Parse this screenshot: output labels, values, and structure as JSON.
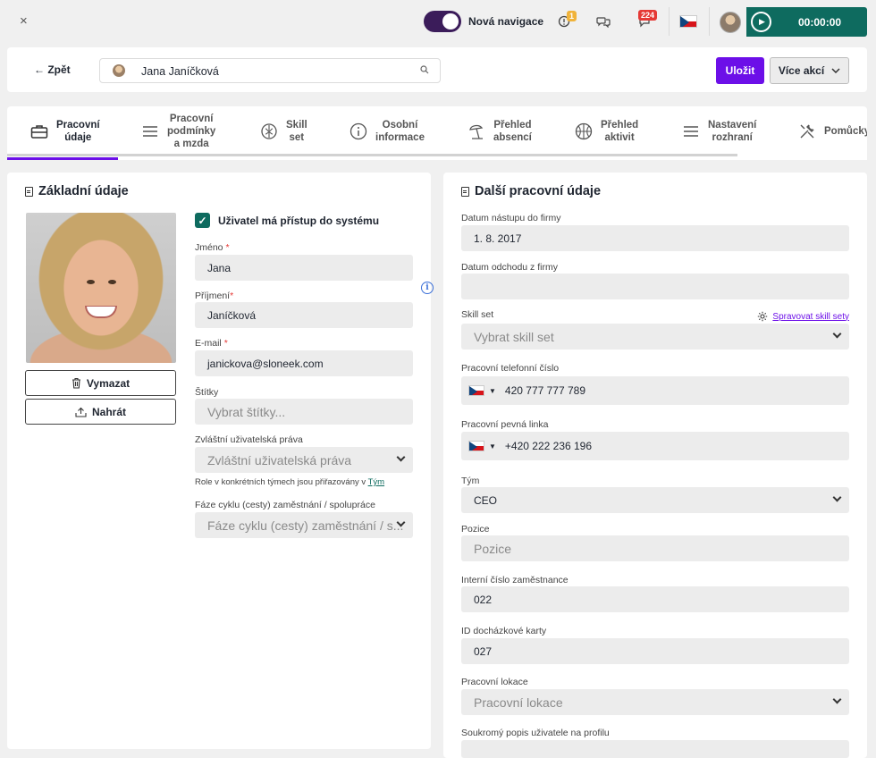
{
  "topbar": {
    "close": "×",
    "nav_toggle_label": "Nová navigace",
    "alert_badge": "1",
    "chat_badge": "224",
    "timer": "00:00:00"
  },
  "header": {
    "back_label": "← Zpět",
    "search_value": "Jana Janíčková",
    "save_label": "Uložit",
    "more_label": "Více akcí"
  },
  "tabs": [
    {
      "label": "Pracovní\núdaje",
      "icon": "briefcase-icon"
    },
    {
      "label": "Pracovní\npodmínky\na mzda",
      "icon": "menu-lines-icon"
    },
    {
      "label": "Skill\nset",
      "icon": "brain-icon"
    },
    {
      "label": "Osobní\ninformace",
      "icon": "info-icon"
    },
    {
      "label": "Přehled\nabsencí",
      "icon": "beach-umbrella-icon"
    },
    {
      "label": "Přehled\naktivit",
      "icon": "basketball-icon"
    },
    {
      "label": "Nastavení\nrozhraní",
      "icon": "menu-lines-icon"
    },
    {
      "label": "Pomůcky",
      "icon": "tools-icon"
    }
  ],
  "left_panel": {
    "title": "Základní údaje",
    "delete_label": "Vymazat",
    "upload_label": "Nahrát",
    "access_label": "Uživatel má přístup do systému",
    "first_name_label": "Jméno",
    "first_name": "Jana",
    "last_name_label": "Příjmení",
    "last_name": "Janíčková",
    "email_label": "E-mail",
    "email": "janickova@sloneek.com",
    "tags_label": "Štítky",
    "tags_placeholder": "Vybrat štítky...",
    "special_rights_label": "Zvláštní uživatelská práva",
    "special_rights_placeholder": "Zvláštní uživatelská práva",
    "roles_hint": "Role v konkrétních týmech jsou přiřazovány v",
    "roles_link": "Tým",
    "phase_label": "Fáze cyklu (cesty) zaměstnání / spolupráce",
    "phase_placeholder": "Fáze cyklu (cesty) zaměstnání / s..."
  },
  "right_panel": {
    "title": "Další pracovní údaje",
    "start_label": "Datum nástupu do firmy",
    "start_value": "1. 8. 2017",
    "end_label": "Datum odchodu z firmy",
    "end_value": "",
    "skill_label": "Skill set",
    "skill_link": "Spravovat skill sety",
    "skill_placeholder": "Vybrat skill set",
    "work_phone_label": "Pracovní telefonní číslo",
    "work_phone": "420 777 777 789",
    "landline_label": "Pracovní pevná linka",
    "landline": "+420 222 236 196",
    "team_label": "Tým",
    "team_value": "CEO",
    "position_label": "Pozice",
    "position_placeholder": "Pozice",
    "employee_no_label": "Interní číslo zaměstnance",
    "employee_no": "022",
    "card_id_label": "ID docházkové karty",
    "card_id": "027",
    "location_label": "Pracovní lokace",
    "location_placeholder": "Pracovní lokace",
    "private_desc_label": "Soukromý popis uživatele na profilu"
  },
  "colors": {
    "accent": "#6c0fe8",
    "teal": "#0e6b5f",
    "toggle": "#3b1c5a"
  }
}
